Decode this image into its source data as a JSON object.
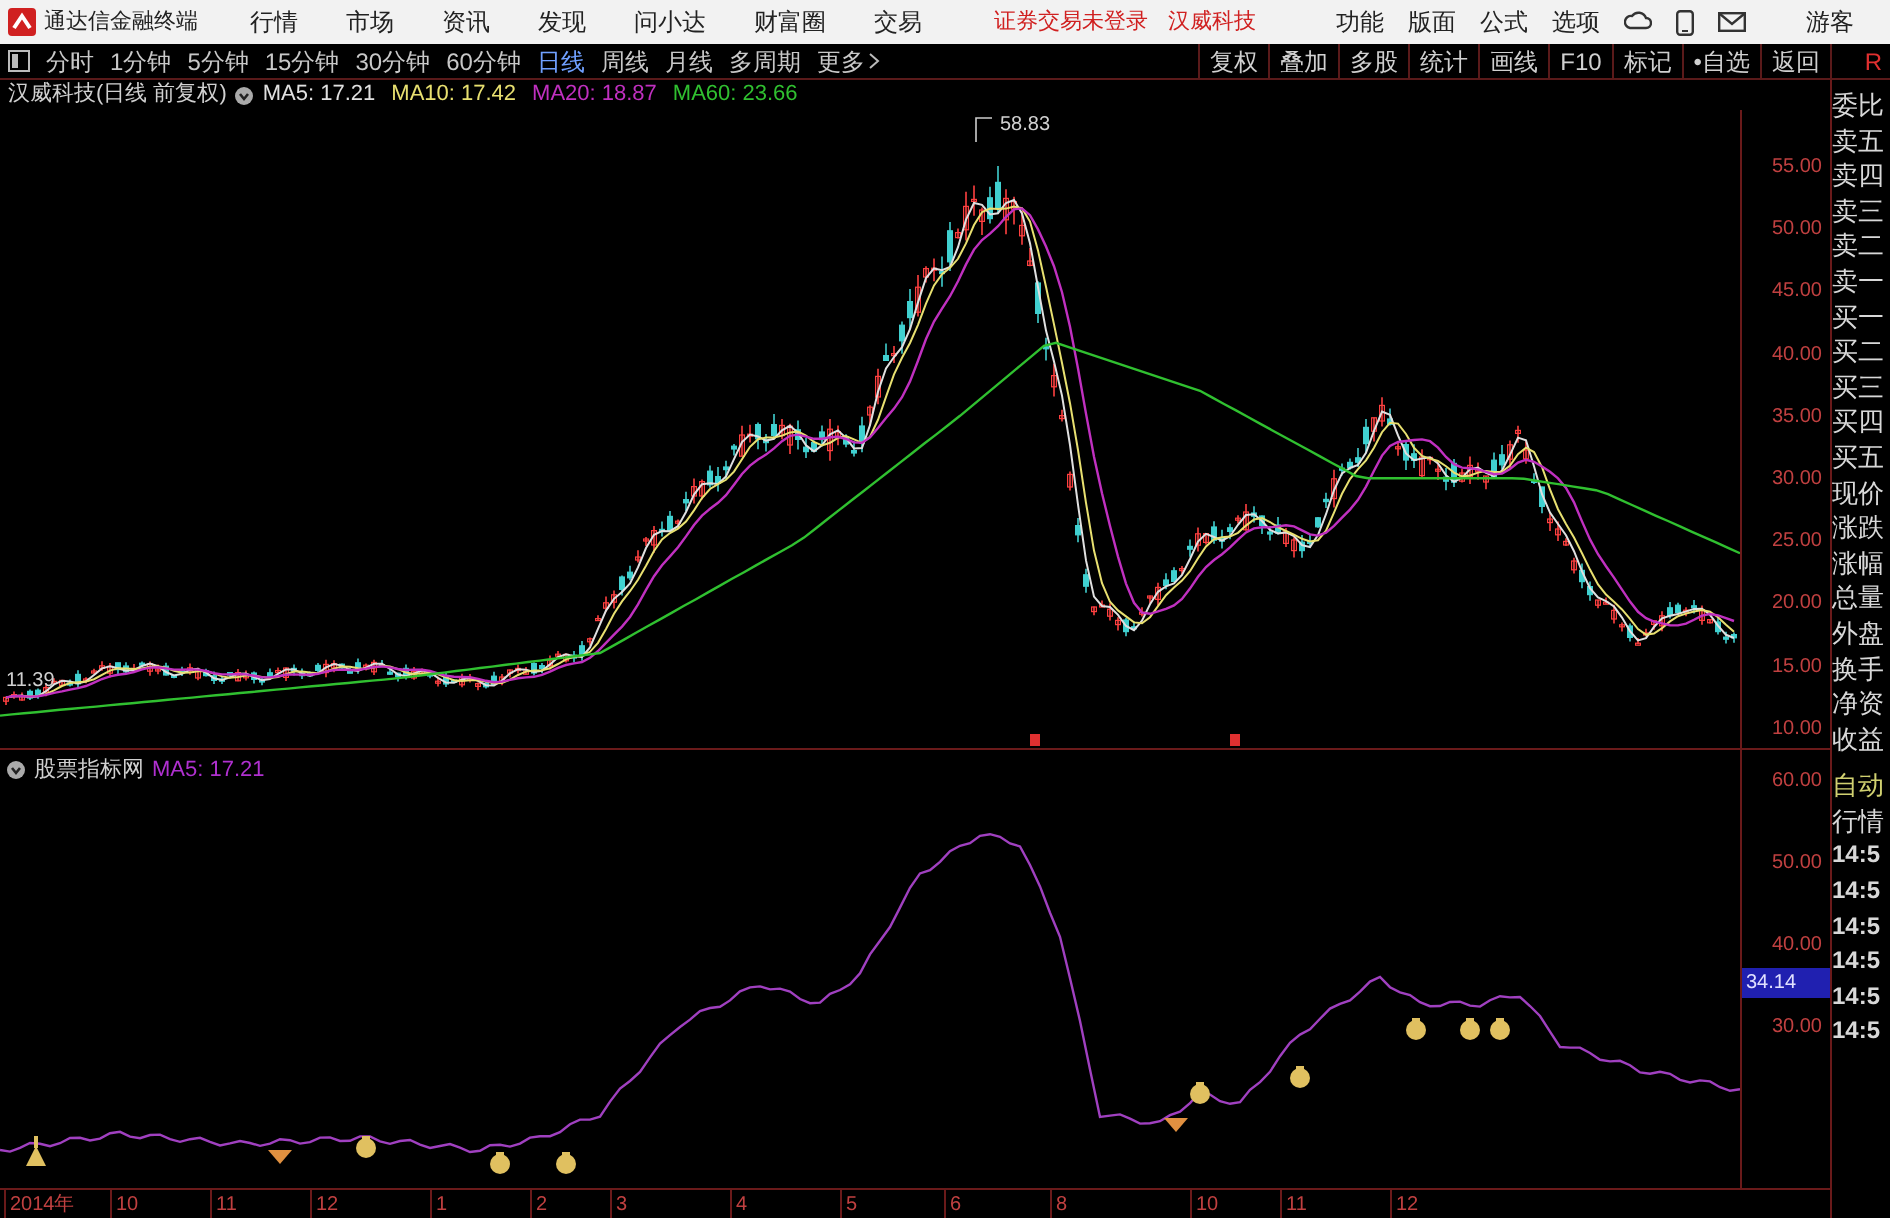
{
  "title_bar": {
    "app_name": "通达信金融终端",
    "menu": [
      "行情",
      "市场",
      "资讯",
      "发现",
      "问小达",
      "财富圈",
      "交易"
    ],
    "notices": [
      "证券交易未登录",
      "汉威科技"
    ],
    "right_menu": [
      "功能",
      "版面",
      "公式",
      "选项"
    ],
    "user": "游客"
  },
  "period_tabs": [
    {
      "label": "分时",
      "selected": false
    },
    {
      "label": "1分钟",
      "selected": false
    },
    {
      "label": "5分钟",
      "selected": false
    },
    {
      "label": "15分钟",
      "selected": false
    },
    {
      "label": "30分钟",
      "selected": false
    },
    {
      "label": "60分钟",
      "selected": false
    },
    {
      "label": "日线",
      "selected": true
    },
    {
      "label": "周线",
      "selected": false
    },
    {
      "label": "月线",
      "selected": false
    },
    {
      "label": "多周期",
      "selected": false
    },
    {
      "label": "更多",
      "selected": false
    }
  ],
  "tools": [
    "复权",
    "叠加",
    "多股",
    "统计",
    "画线",
    "F10",
    "标记",
    "•自选",
    "返回"
  ],
  "edge_letter": "R",
  "main_chart": {
    "title": "汉威科技(日线 前复权)",
    "indicators": [
      {
        "label": "MA5: 17.21",
        "color": "#e0e0e0"
      },
      {
        "label": "MA10: 17.42",
        "color": "#e8e070"
      },
      {
        "label": "MA20: 18.87",
        "color": "#c030c0"
      },
      {
        "label": "MA60: 23.66",
        "color": "#30c030"
      }
    ],
    "high_label": "58.83",
    "low_label": "11.39",
    "price_ticks": [
      "55.00",
      "50.00",
      "45.00",
      "40.00",
      "35.00",
      "30.00",
      "25.00",
      "20.00",
      "15.00",
      "10.00"
    ]
  },
  "quote_panel": {
    "labels": [
      "委比",
      "卖五",
      "卖四",
      "卖三",
      "卖二",
      "卖一",
      "买一",
      "买二",
      "买三",
      "买四",
      "买五",
      "现价",
      "涨跌",
      "涨幅",
      "总量",
      "外盘",
      "换手",
      "净资",
      "收益"
    ],
    "mode_labels": [
      "自动",
      "行情"
    ],
    "times": [
      "14:5",
      "14:5",
      "14:5",
      "14:5",
      "14:5",
      "14:5"
    ]
  },
  "indicator_chart": {
    "title": "股票指标网",
    "indicators": [
      {
        "label": "MA5: 17.21",
        "color": "#b030d0"
      }
    ],
    "ticks": [
      "60.00",
      "50.00",
      "40.00",
      "30.00"
    ],
    "current_value": "34.14"
  },
  "date_axis": [
    "2014年",
    "10",
    "11",
    "12",
    "1",
    "2",
    "3",
    "4",
    "5",
    "6",
    "8",
    "10",
    "11",
    "12"
  ]
}
